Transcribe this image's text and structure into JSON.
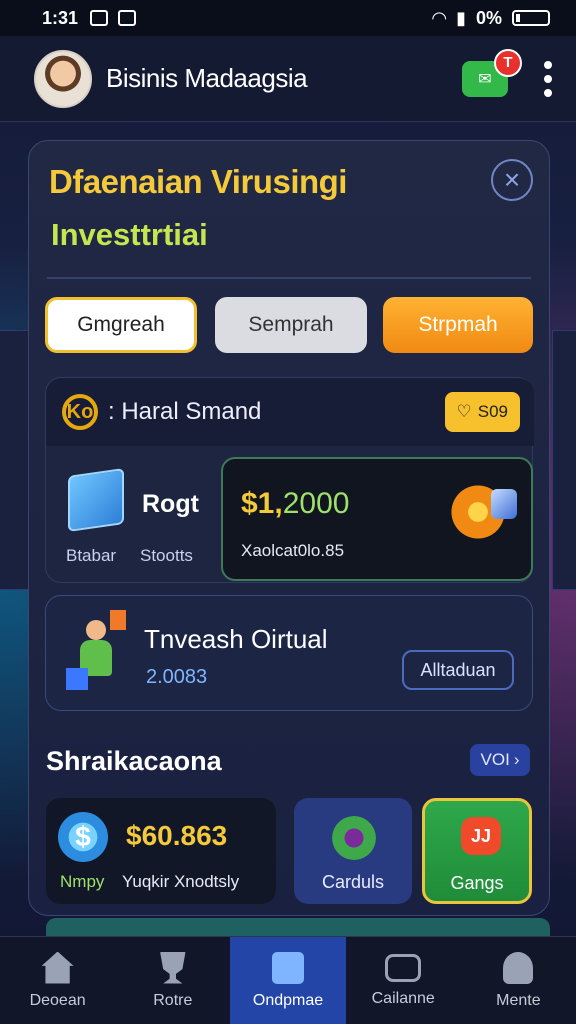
{
  "status_bar": {
    "time": "1:31",
    "battery": "0%"
  },
  "app_bar": {
    "title": "Bisinis Madaagsia",
    "badge": "T"
  },
  "panel": {
    "title_line1": "Dfaenaian Virusingi",
    "title_line2": "Investtrtiai",
    "close_icon": "×",
    "tabs": [
      "Gmgreah",
      "Semprah",
      "Strpmah"
    ],
    "info": {
      "icon_text": "Ko",
      "label": ": Haral Smand",
      "pill_value": "S09",
      "asset_label": "Rogt",
      "sub1": "Btabar",
      "sub2": "Stootts",
      "balance_a": "$1,",
      "balance_b": "2000",
      "balance_sub": "Xaolcat0lo.85"
    },
    "investment": {
      "title": "Tnveash Oirtual",
      "value": "2.0083",
      "button": "Alltaduan"
    }
  },
  "section": {
    "title": "Shraikacaona",
    "button": "VOI",
    "cards": [
      {
        "value": "$60.863",
        "label_a": "Nmpy",
        "label_b": "Yuqkir Xnodtsly",
        "icon": "$"
      },
      {
        "label": "Carduls"
      },
      {
        "label": "Gangs",
        "icon": "JJ"
      }
    ]
  },
  "nav": [
    {
      "label": "Deoean",
      "icon": "home-icon"
    },
    {
      "label": "Rotre",
      "icon": "trophy-icon"
    },
    {
      "label": "Ondpmae",
      "icon": "list-icon"
    },
    {
      "label": "Cailanne",
      "icon": "chat-icon"
    },
    {
      "label": "Mente",
      "icon": "user-icon"
    }
  ],
  "colors": {
    "accent_yellow": "#f4c93a",
    "accent_green": "#9fe06a",
    "active_nav": "#2345a8"
  }
}
